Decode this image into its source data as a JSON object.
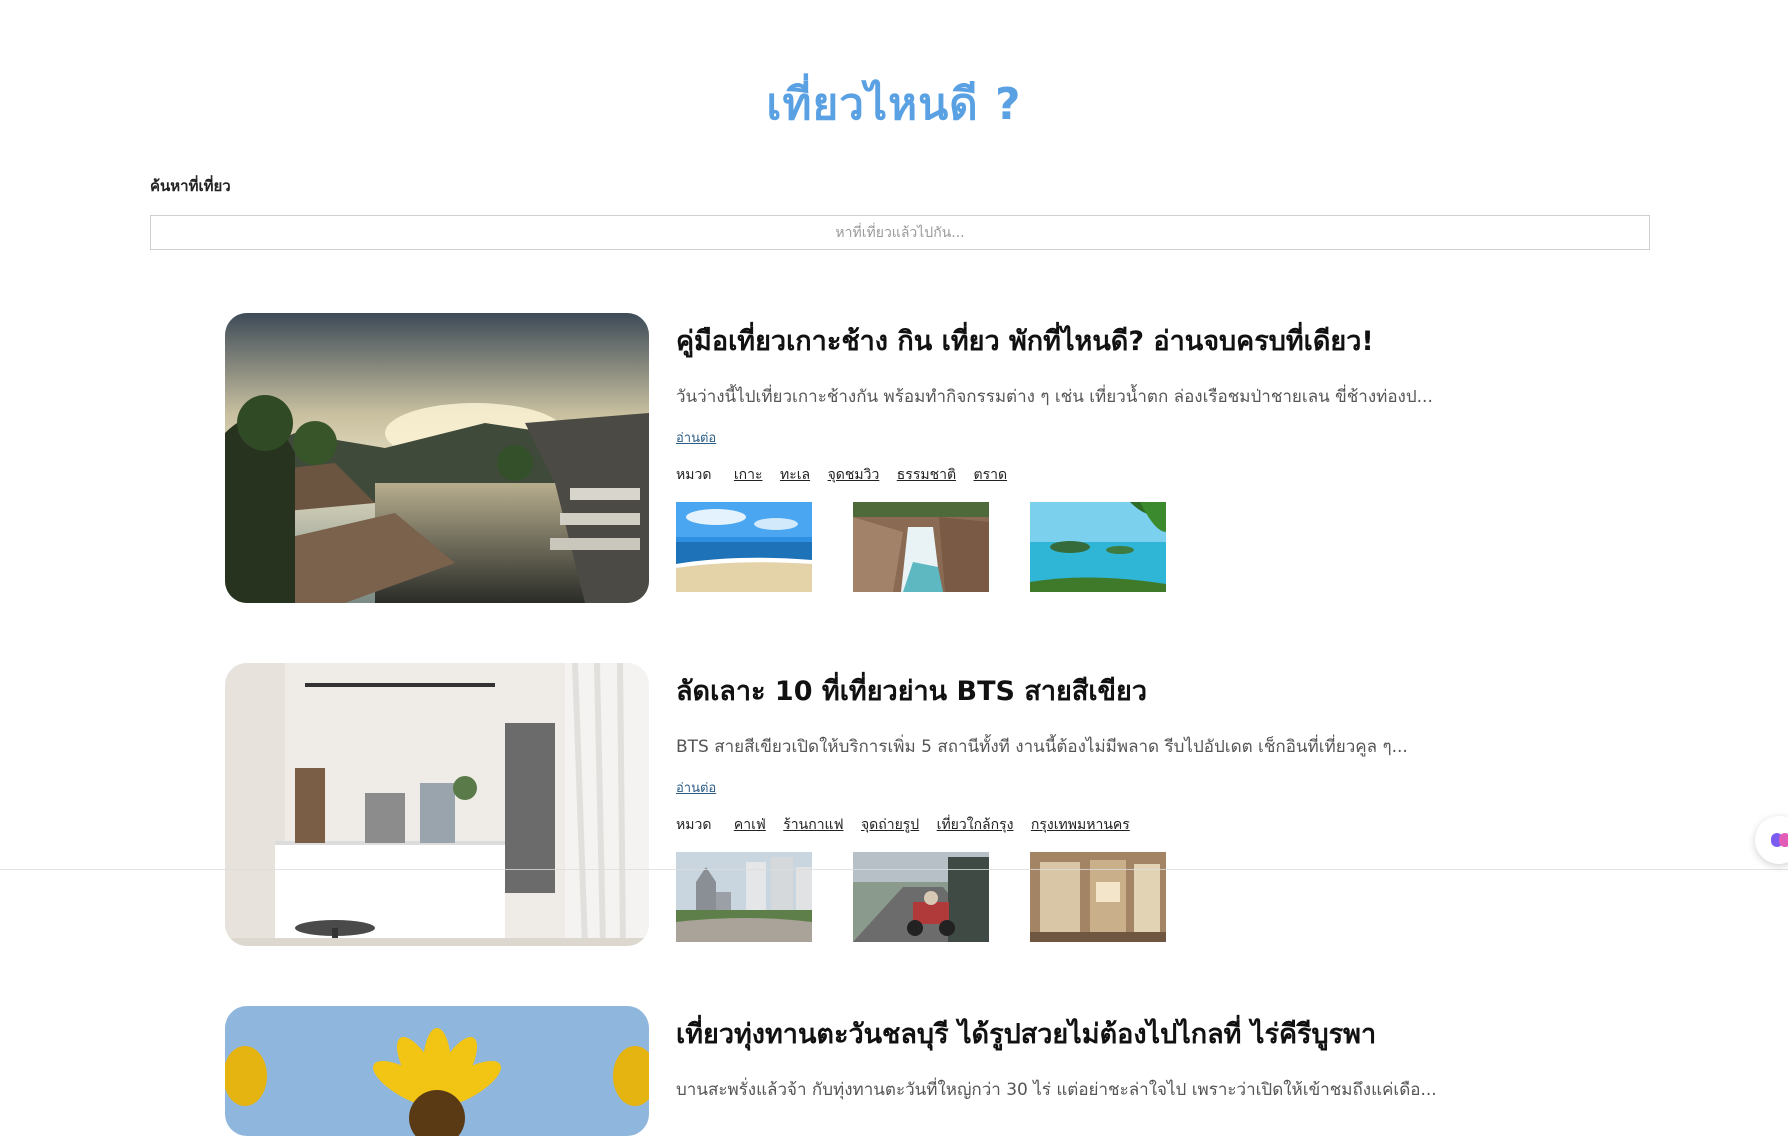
{
  "page": {
    "title": "เที่ยวไหนดี ?"
  },
  "search": {
    "label": "ค้นหาที่เที่ยว",
    "placeholder": "หาที่เที่ยวแล้วไปกัน..."
  },
  "articles": [
    {
      "title": "คู่มือเที่ยวเกาะช้าง กิน เที่ยว พักที่ไหนดี? อ่านจบครบที่เดียว!",
      "excerpt": "วันว่างนี้ไปเที่ยวเกาะช้างกัน พร้อมทำกิจกรรมต่าง ๆ เช่น เที่ยวน้ำตก ล่องเรือชมป่าชายเลน ขี่ช้างท่องป...",
      "read_more": "อ่านต่อ",
      "category_label": "หมวด",
      "tags": [
        "เกาะ",
        "ทะเล",
        "จุดชมวิว",
        "ธรรมชาติ",
        "ตราด"
      ]
    },
    {
      "title": "ลัดเลาะ 10 ที่เที่ยวย่าน BTS สายสีเขียว",
      "excerpt": "BTS สายสีเขียวเปิดให้บริการเพิ่ม 5 สถานีทั้งที งานนี้ต้องไม่มีพลาด รีบไปอัปเดต เช็กอินที่เที่ยวคูล ๆ...",
      "read_more": "อ่านต่อ",
      "category_label": "หมวด",
      "tags": [
        "คาเฟ่",
        "ร้านกาแฟ",
        "จุดถ่ายรูป",
        "เที่ยวใกล้กรุง",
        "กรุงเทพมหานคร"
      ]
    },
    {
      "title": "เที่ยวทุ่งทานตะวันชลบุรี ได้รูปสวยไม่ต้องไปไกลที่ ไร่คีรีบูรพา",
      "excerpt": "บานสะพรั่งแล้วจ้า กับทุ่งทานตะวันที่ใหญ่กว่า 30 ไร่ แต่อย่าชะล่าใจไป เพราะว่าเปิดให้เข้าชมถึงแค่เดือ..."
    }
  ],
  "colors": {
    "title": "#5aa1e3",
    "link": "#2b5d86",
    "border": "#cfcfcf"
  }
}
